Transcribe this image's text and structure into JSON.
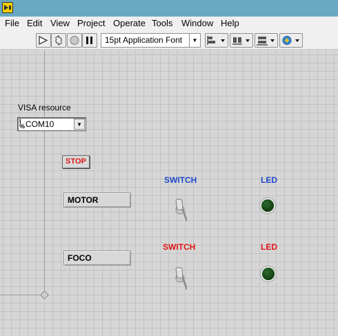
{
  "menu": [
    "File",
    "Edit",
    "View",
    "Project",
    "Operate",
    "Tools",
    "Window",
    "Help"
  ],
  "toolbar": {
    "font_selector": "15pt Application Font",
    "icons": [
      "run-arrow-icon",
      "run-continuously-icon",
      "abort-icon",
      "pause-icon",
      "align-icon",
      "distribute-icon",
      "resize-icon",
      "reorder-icon"
    ]
  },
  "visa": {
    "label": "VISA resource",
    "value": "COM10"
  },
  "stop_button": "STOP",
  "rows": [
    {
      "name": "MOTOR",
      "switch_label": "SWITCH",
      "led_label": "LED",
      "color": "#1e49c8"
    },
    {
      "name": "FOCO",
      "switch_label": "SWITCH",
      "led_label": "LED",
      "color": "#e01515"
    }
  ],
  "colors": {
    "titlebar": "#6aa9c1",
    "blue_label": "#1e49c8",
    "red_label": "#e01515",
    "led_off": "#1e4d1e"
  }
}
